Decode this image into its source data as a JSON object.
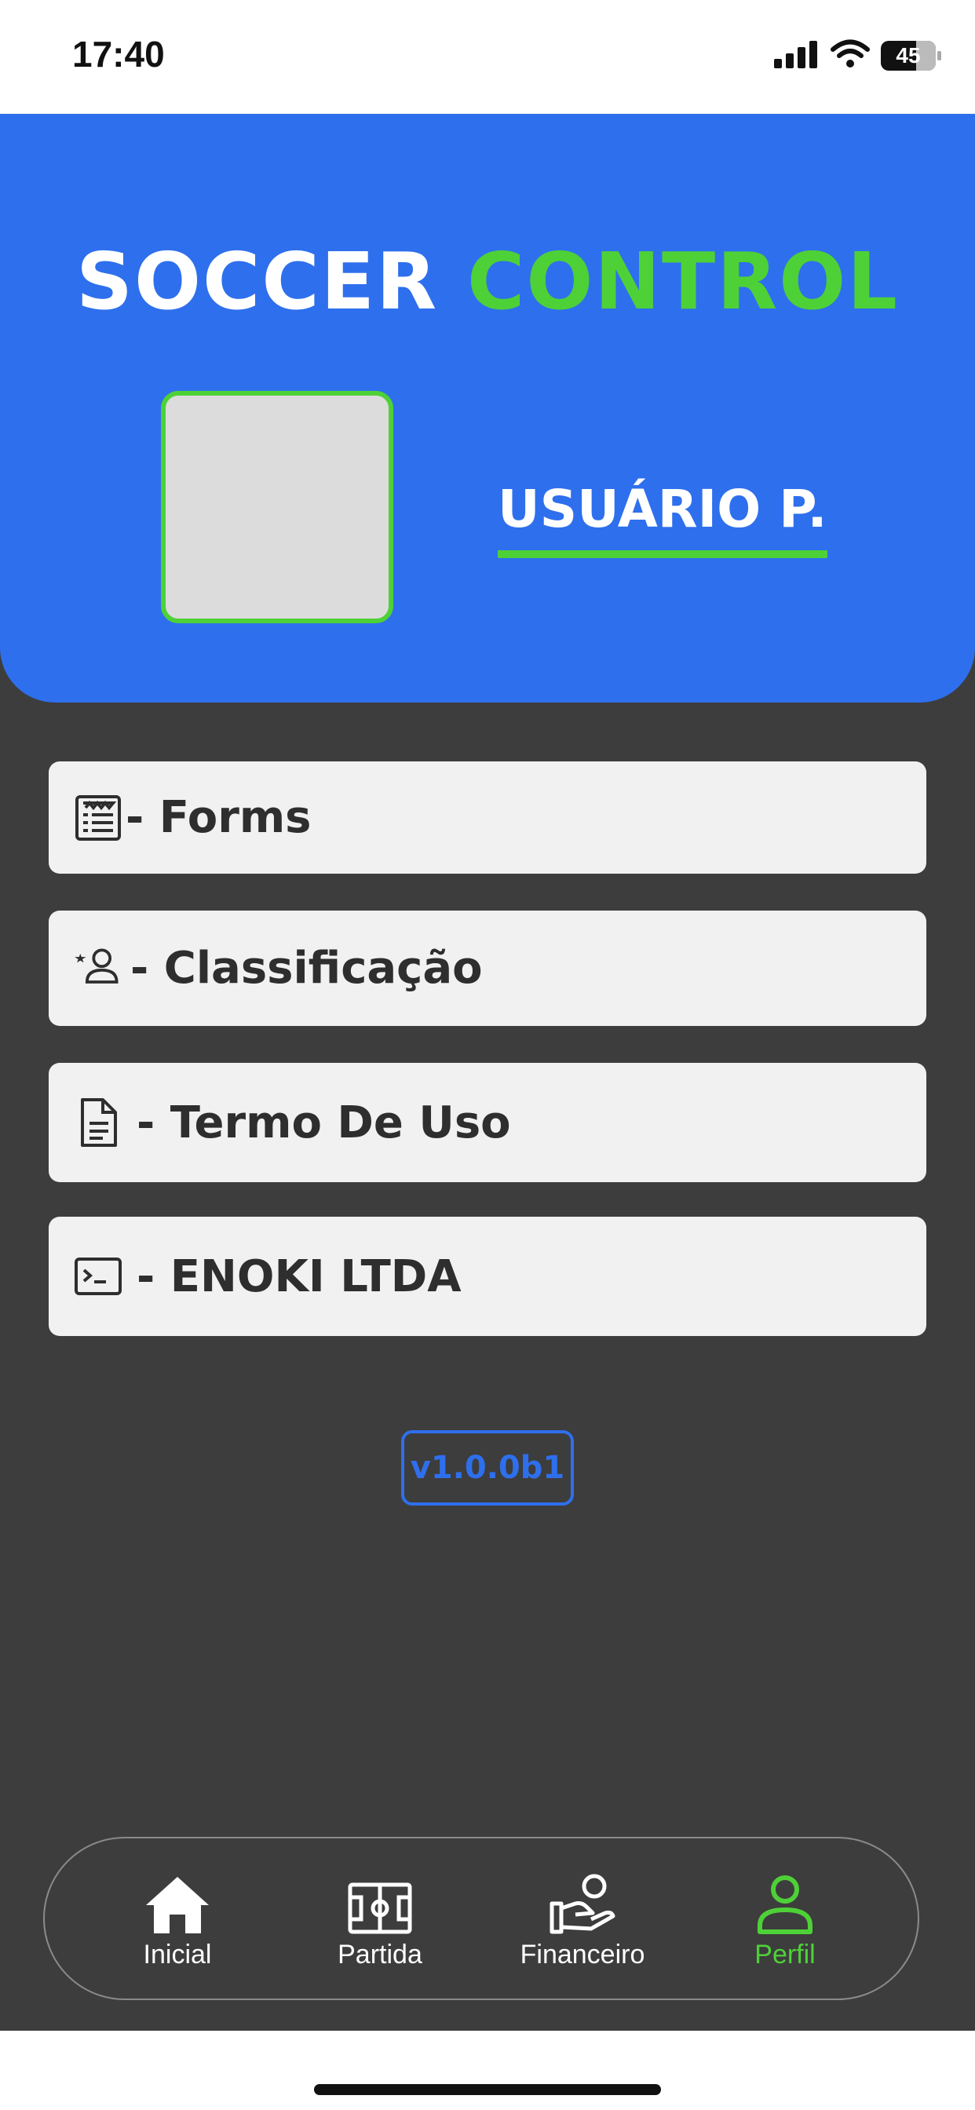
{
  "status_bar": {
    "time": "17:40",
    "battery": "45"
  },
  "header": {
    "title_part1": "SOCCER",
    "title_part2": "CONTROL",
    "user_name": "USUÁRIO P."
  },
  "menu": [
    {
      "icon": "form-icon",
      "label": "- Forms"
    },
    {
      "icon": "user-star-icon",
      "label": "- Classificação"
    },
    {
      "icon": "document-icon",
      "label": "- Termo De Uso"
    },
    {
      "icon": "terminal-icon",
      "label": "- ENOKI LTDA"
    }
  ],
  "version": "v1.0.0b1",
  "bottom_nav": [
    {
      "icon": "home-icon",
      "label": "Inicial",
      "active": false
    },
    {
      "icon": "soccer-field-icon",
      "label": "Partida",
      "active": false
    },
    {
      "icon": "hand-coin-icon",
      "label": "Financeiro",
      "active": false
    },
    {
      "icon": "person-icon",
      "label": "Perfil",
      "active": true
    }
  ],
  "colors": {
    "header_blue": "#2e6fed",
    "accent_green": "#4ed137",
    "background_dark": "#3d3d3d",
    "menu_item_bg": "#f1f1f1"
  }
}
